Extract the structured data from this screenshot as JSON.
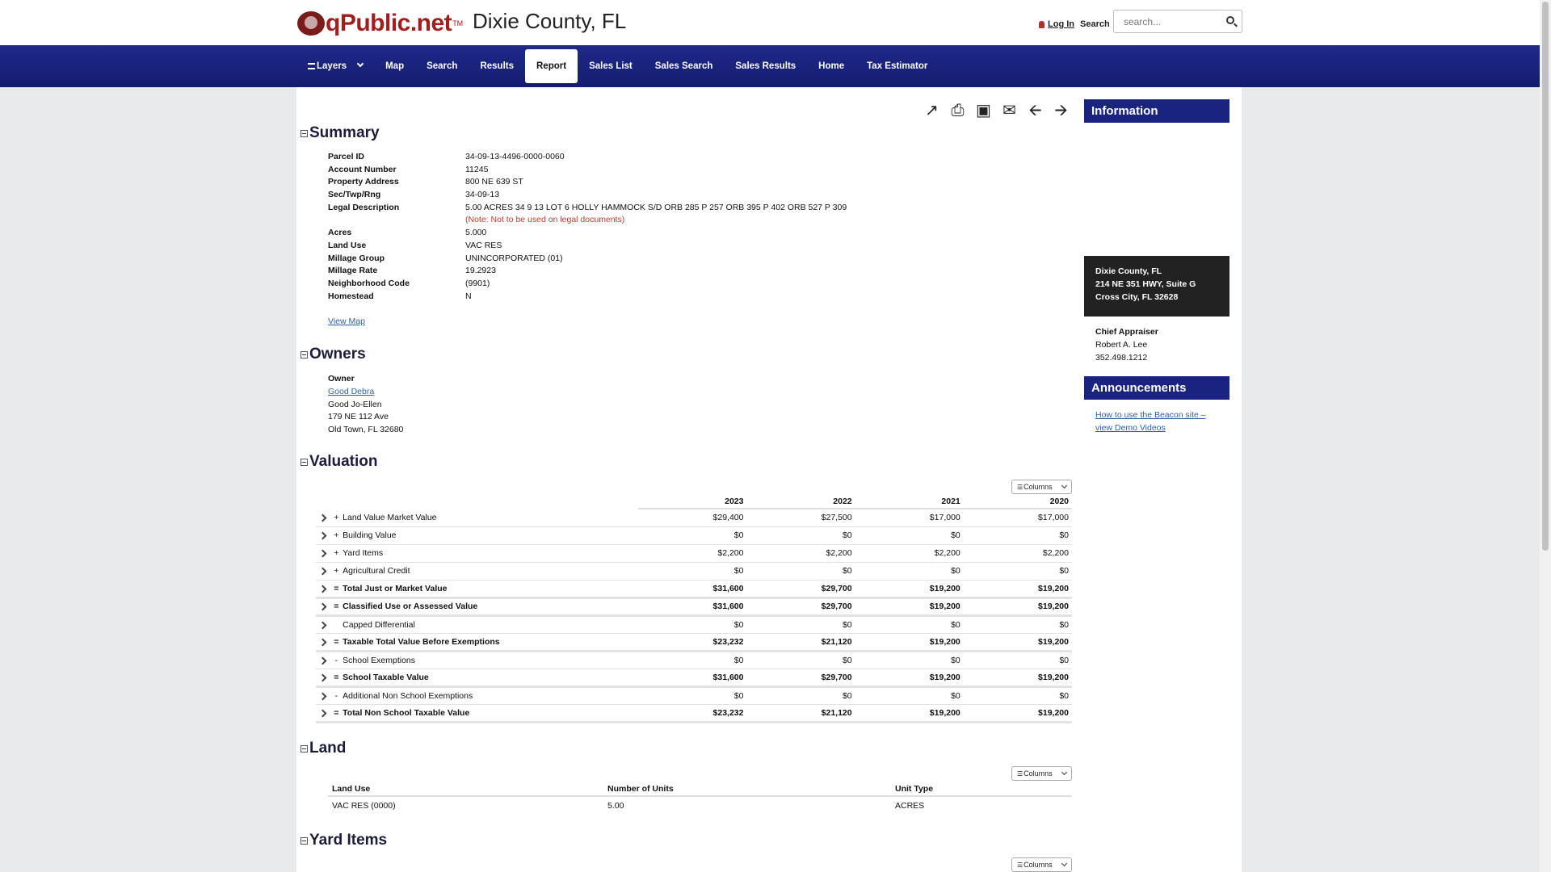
{
  "header": {
    "logo_text": "qPublic.net",
    "logo_tm": "TM",
    "county_title": "Dixie County, FL",
    "login_label": "Log In",
    "search_label": "Search",
    "search_placeholder": "search..."
  },
  "nav": {
    "items": [
      {
        "label": "Layers"
      },
      {
        "label": "Map"
      },
      {
        "label": "Search"
      },
      {
        "label": "Results"
      },
      {
        "label": "Report"
      },
      {
        "label": "Sales List"
      },
      {
        "label": "Sales Search"
      },
      {
        "label": "Sales Results"
      },
      {
        "label": "Home"
      },
      {
        "label": "Tax Estimator"
      }
    ],
    "active": "Report"
  },
  "toolbar": {
    "icons": [
      "share-icon",
      "print-icon",
      "image-icon",
      "mail-icon",
      "arrow-left-icon",
      "arrow-right-icon"
    ]
  },
  "summary": {
    "title": "Summary",
    "rows": [
      {
        "k": "Parcel ID",
        "v": "34-09-13-4496-0000-0060"
      },
      {
        "k": "Account Number",
        "v": "11245"
      },
      {
        "k": "Property Address",
        "v": "800 NE 639 ST"
      },
      {
        "k": "Sec/Twp/Rng",
        "v": "34-09-13"
      },
      {
        "k": "Legal Description",
        "v": "5.00 ACRES 34 9 13 LOT 6 HOLLY HAMMOCK S/D ORB 285 P 257 ORB 395 P 402 ORB 527 P 309"
      },
      {
        "k": "",
        "v": "(Note: Not to be used on legal documents)"
      },
      {
        "k": "Acres",
        "v": "5.000"
      },
      {
        "k": "Land Use",
        "v": "VAC RES"
      },
      {
        "k": "Millage Group",
        "v": "UNINCORPORATED (01)"
      },
      {
        "k": "Millage Rate",
        "v": "19.2923"
      },
      {
        "k": "Neighborhood Code",
        "v": "(9901)"
      },
      {
        "k": "Homestead",
        "v": "N"
      }
    ],
    "view_map": "View Map"
  },
  "owners": {
    "title": "Owners",
    "label": "Owner",
    "name_link": "Good Debra",
    "lines": [
      "Good Jo-Ellen",
      "179 NE 112 Ave",
      "Old Town, FL 32680"
    ]
  },
  "valuation": {
    "title": "Valuation",
    "columns_label": "Columns",
    "years": [
      "2023",
      "2022",
      "2021",
      "2020"
    ],
    "rows": [
      {
        "op": "+",
        "label": "Land Value Market Value",
        "values": [
          "$29,400",
          "$27,500",
          "$17,000",
          "$17,000"
        ],
        "bold": false
      },
      {
        "op": "+",
        "label": "Building Value",
        "values": [
          "$0",
          "$0",
          "$0",
          "$0"
        ],
        "bold": false
      },
      {
        "op": "+",
        "label": "Yard Items",
        "values": [
          "$2,200",
          "$2,200",
          "$2,200",
          "$2,200"
        ],
        "bold": false
      },
      {
        "op": "+",
        "label": "Agricultural Credit",
        "values": [
          "$0",
          "$0",
          "$0",
          "$0"
        ],
        "bold": false
      },
      {
        "op": "=",
        "label": "Total Just or Market Value",
        "values": [
          "$31,600",
          "$29,700",
          "$19,200",
          "$19,200"
        ],
        "bold": true
      },
      {
        "op": "=",
        "label": "Classified Use or Assessed Value",
        "values": [
          "$31,600",
          "$29,700",
          "$19,200",
          "$19,200"
        ],
        "bold": true
      },
      {
        "op": "",
        "label": "Capped Differential",
        "values": [
          "$0",
          "$0",
          "$0",
          "$0"
        ],
        "bold": false
      },
      {
        "op": "=",
        "label": "Taxable Total Value Before Exemptions",
        "values": [
          "$23,232",
          "$21,120",
          "$19,200",
          "$19,200"
        ],
        "bold": true
      },
      {
        "op": "-",
        "label": "School Exemptions",
        "values": [
          "$0",
          "$0",
          "$0",
          "$0"
        ],
        "bold": false
      },
      {
        "op": "=",
        "label": "School Taxable Value",
        "values": [
          "$31,600",
          "$29,700",
          "$19,200",
          "$19,200"
        ],
        "bold": true
      },
      {
        "op": "-",
        "label": "Additional Non School Exemptions",
        "values": [
          "$0",
          "$0",
          "$0",
          "$0"
        ],
        "bold": false
      },
      {
        "op": "=",
        "label": "Total Non School Taxable Value",
        "values": [
          "$23,232",
          "$21,120",
          "$19,200",
          "$19,200"
        ],
        "bold": true
      }
    ]
  },
  "land": {
    "title": "Land",
    "columns_label": "Columns",
    "headers": [
      "Land Use",
      "Number of Units",
      "Unit Type"
    ],
    "rows": [
      [
        "VAC RES (0000)",
        "5.00",
        "ACRES"
      ]
    ]
  },
  "yard_items": {
    "title": "Yard Items",
    "columns_label": "Columns"
  },
  "sidebar": {
    "info_title": "Information",
    "office": [
      "Dixie County, FL",
      "214 NE 351 HWY, Suite G",
      "Cross City, FL 32628"
    ],
    "appraiser_label": "Chief Appraiser",
    "appraiser_lines": [
      "Robert A. Lee",
      "352.498.1212"
    ],
    "announcements_title": "Announcements",
    "announcement_link": "How to use the Beacon site – view Demo Videos"
  },
  "colors": {
    "nav_bg": "#1a237e",
    "brand_red": "#a01e1e",
    "link": "#2e5fa3",
    "note_red": "#c0392b"
  }
}
